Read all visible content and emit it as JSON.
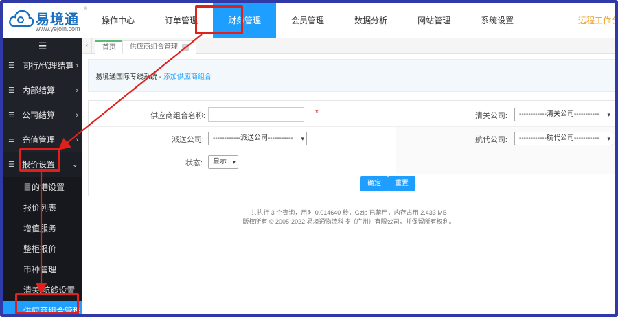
{
  "header": {
    "logo_title": "易境通",
    "logo_url": "www.yejoin.com",
    "logo_reg": "®",
    "nav": [
      "操作中心",
      "订单管理",
      "财务管理",
      "会员管理",
      "数据分析",
      "网站管理",
      "系统设置"
    ],
    "active_nav": "财务管理",
    "right_text": "远程工作台"
  },
  "sidebar": {
    "toggle": "☰",
    "items": [
      {
        "label": "同行/代理结算"
      },
      {
        "label": "内部结算"
      },
      {
        "label": "公司结算"
      },
      {
        "label": "充值管理"
      },
      {
        "label": "报价设置"
      }
    ],
    "sub_items": [
      "目的港设置",
      "报价列表",
      "增值服务",
      "整柜报价",
      "币种管理",
      "清关/航线设置",
      "供应商组合管理"
    ],
    "current_sub": "供应商组合管理"
  },
  "tabs": {
    "prev": "‹",
    "home": "首页",
    "current": "供应商组合管理",
    "close": "×"
  },
  "breadcrumb": {
    "system": "易境通国际专线系统",
    "separator": " - ",
    "page": "添加供应商组合"
  },
  "form": {
    "combo_name_label": "供应商组合名称:",
    "combo_name_value": "",
    "required_mark": "*",
    "customs_label": "清关公司:",
    "customs_value": "------------清关公司-----------",
    "delivery_label": "派送公司:",
    "delivery_value": "------------派送公司-----------",
    "agent_label": "航代公司:",
    "agent_value": "------------航代公司-----------",
    "status_label": "状态:",
    "status_value": "显示",
    "confirm_button": "确定",
    "reset_button": "重置"
  },
  "footer": {
    "line1": "共执行 3 个查询，用时 0.014640 秒，Gzip 已禁用，内存占用 2.433 MB",
    "line2": "版权所有 © 2005-2022 易境通物流科技（广州）有限公司，并保留所有权利。"
  },
  "colors": {
    "frame": "#2f3aa8",
    "accent": "#1e9fff",
    "annotation": "#e0201a",
    "sidebar_bg": "#20222a"
  },
  "icons": {
    "menu": "list-icon",
    "arrow": "chevron-right-icon",
    "open_arrow": "chevron-down-icon"
  }
}
